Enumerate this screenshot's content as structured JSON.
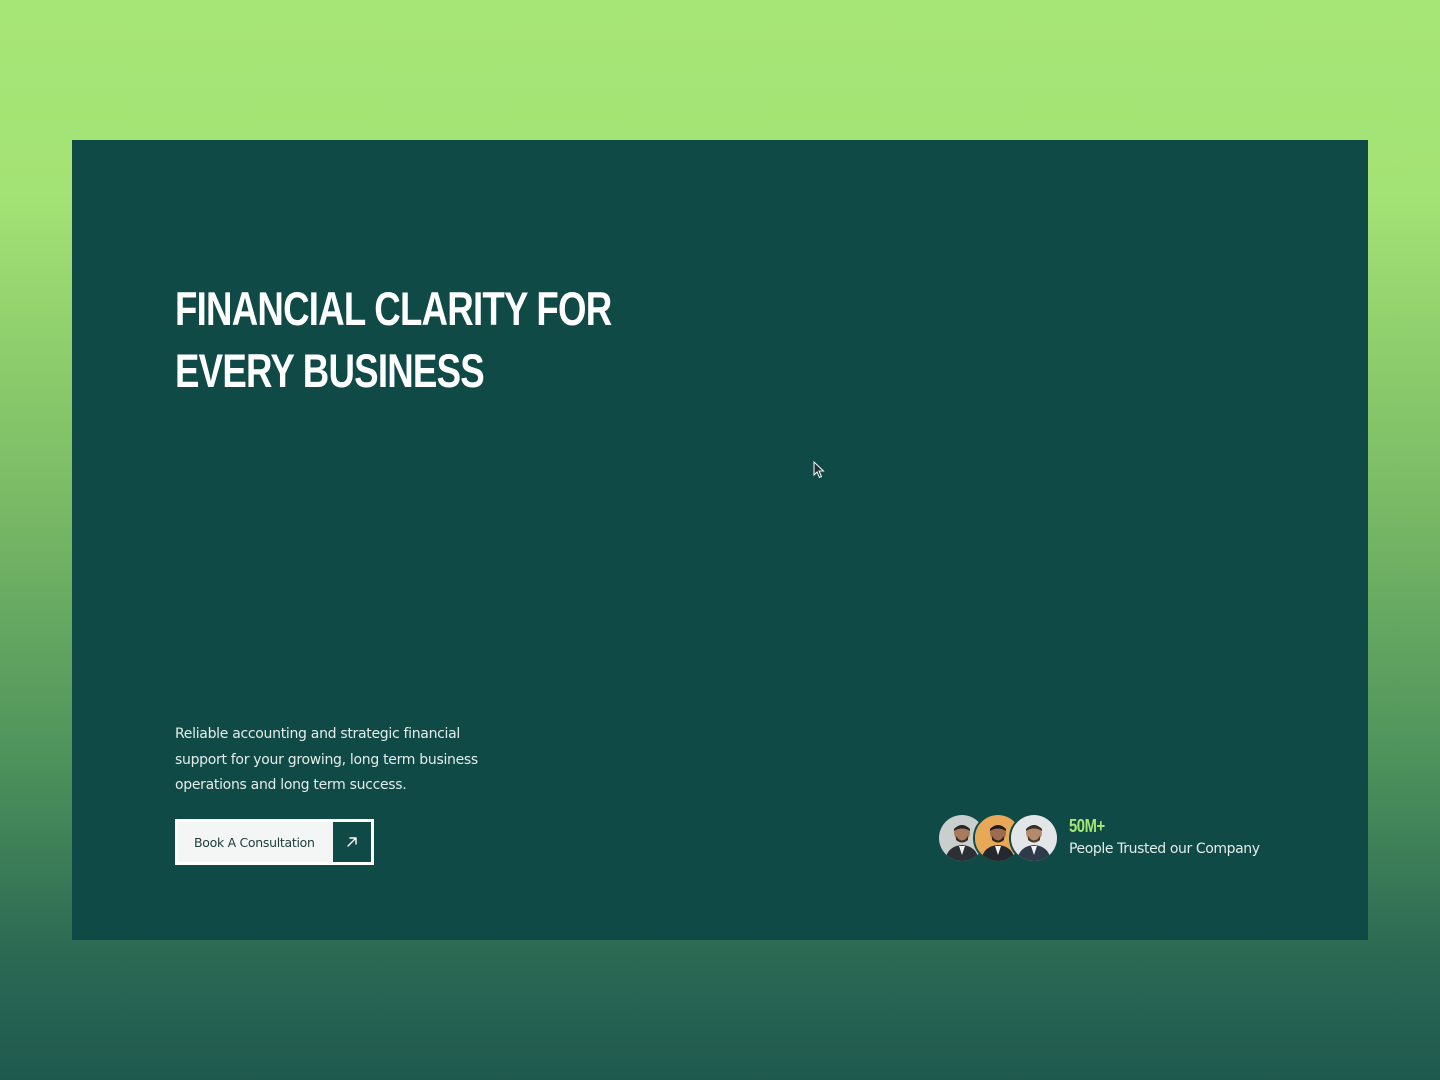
{
  "hero": {
    "title_line1": "FINANCIAL CLARITY FOR",
    "title_line2": "EVERY BUSINESS",
    "description": "Reliable accounting and strategic financial support for your growing, long term business operations and long term success.",
    "cta_label": "Book A Consultation",
    "cta_icon": "arrow-up-right-icon"
  },
  "trust": {
    "count": "50M+",
    "label": "People Trusted our Company",
    "avatars": [
      "person-avatar-1",
      "person-avatar-2",
      "person-avatar-3"
    ]
  },
  "colors": {
    "background_top": "#a6e677",
    "background_bottom": "#1f5a4f",
    "hero_bg": "#0f4a47",
    "accent": "#a6e677",
    "text_light": "#ffffff",
    "button_bg": "#f4f6f5"
  }
}
